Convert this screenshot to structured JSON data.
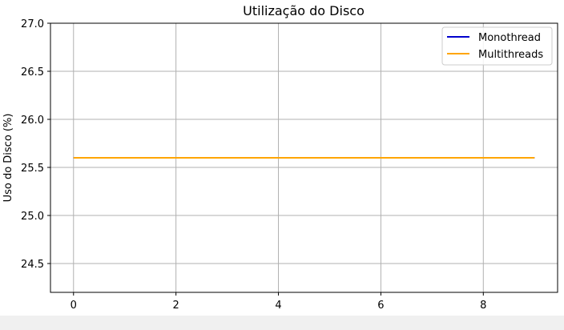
{
  "chart_data": {
    "type": "line",
    "title": "Utilização do Disco",
    "xlabel": "",
    "ylabel": "Uso do Disco (%)",
    "xlim": [
      -0.45,
      9.45
    ],
    "ylim": [
      24.2,
      27.0
    ],
    "x_ticks": [
      0,
      2,
      4,
      6,
      8
    ],
    "y_ticks": [
      24.5,
      25.0,
      25.5,
      26.0,
      26.5,
      27.0
    ],
    "y_tick_labels": [
      "24.5",
      "25.0",
      "25.5",
      "26.0",
      "26.5",
      "27.0"
    ],
    "grid": true,
    "legend_position": "upper right",
    "series": [
      {
        "name": "Monothread",
        "color": "#0000cc",
        "x": [
          0,
          1,
          2,
          3,
          4,
          5,
          6,
          7,
          8,
          9
        ],
        "y": [
          25.6,
          25.6,
          25.6,
          25.6,
          25.6,
          25.6,
          25.6,
          25.6,
          25.6,
          25.6
        ]
      },
      {
        "name": "Multithreads",
        "color": "#ffa500",
        "x": [
          0,
          1,
          2,
          3,
          4,
          5,
          6,
          7,
          8,
          9
        ],
        "y": [
          25.6,
          25.6,
          25.6,
          25.6,
          25.6,
          25.6,
          25.6,
          25.6,
          25.6,
          25.6
        ]
      }
    ]
  }
}
